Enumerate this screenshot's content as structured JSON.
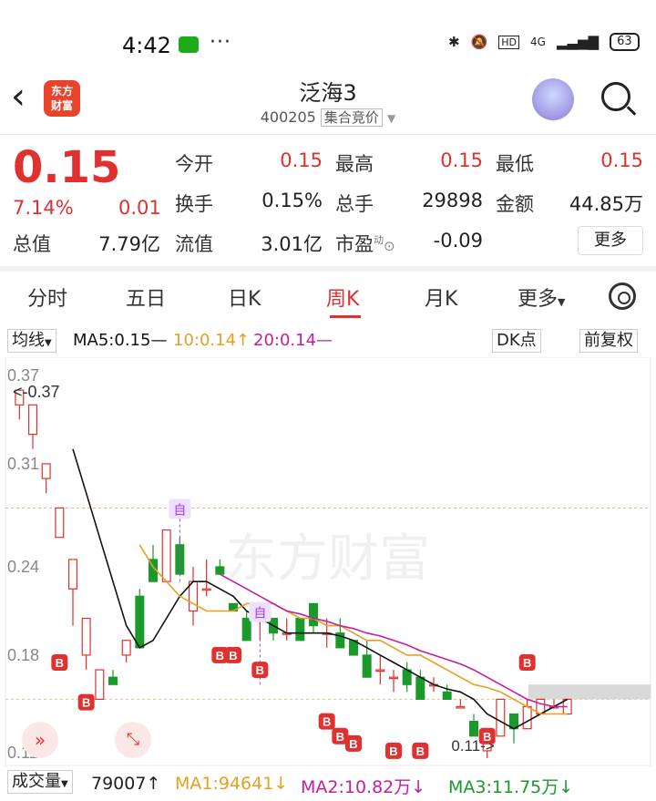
{
  "status": {
    "time": "4:42",
    "dots": "···",
    "network": "4G",
    "battery": "63"
  },
  "header": {
    "title": "泛海3",
    "code": "400205",
    "tag": "集合竞价",
    "logo": "东方\n财富"
  },
  "quote": {
    "price": "0.15",
    "pct": "7.14%",
    "change": "0.01",
    "fields": [
      {
        "label": "今开",
        "value": "0.15",
        "red": true
      },
      {
        "label": "最高",
        "value": "0.15",
        "red": true
      },
      {
        "label": "最低",
        "value": "0.15",
        "red": true
      },
      {
        "label": "换手",
        "value": "0.15%"
      },
      {
        "label": "总手",
        "value": "29898"
      },
      {
        "label": "金额",
        "value": "44.85万"
      },
      {
        "label": "总值",
        "value": "7.79亿"
      },
      {
        "label": "流值",
        "value": "3.01亿"
      },
      {
        "label": "市盈",
        "value": "-0.09"
      }
    ],
    "more": "更多",
    "pe_sup": "动"
  },
  "tabs": [
    "分时",
    "五日",
    "日K",
    "周K",
    "月K",
    "更多"
  ],
  "active_tab": "周K",
  "ma_bar": {
    "select": "均线",
    "ma5": "MA5:0.15—",
    "ma10": "10:0.14↑",
    "ma20": "20:0.14—",
    "dk": "DK点",
    "fq": "前复权"
  },
  "chart_data": {
    "type": "candlestick",
    "y_ticks": [
      "0.37",
      "0.31",
      "0.24",
      "0.18",
      "0.11"
    ],
    "ylim": [
      0.11,
      0.37
    ],
    "max_label": "<-0.37",
    "min_label": "0.11->",
    "marker_label": "自",
    "b_label": "B",
    "watermark": "东方财富",
    "candles": [
      {
        "o": 0.35,
        "h": 0.36,
        "l": 0.34,
        "c": 0.36
      },
      {
        "o": 0.33,
        "h": 0.35,
        "l": 0.32,
        "c": 0.35
      },
      {
        "o": 0.3,
        "h": 0.31,
        "l": 0.29,
        "c": 0.31
      },
      {
        "o": 0.26,
        "h": 0.28,
        "l": 0.26,
        "c": 0.28
      },
      {
        "o": 0.225,
        "h": 0.245,
        "l": 0.2,
        "c": 0.245
      },
      {
        "o": 0.18,
        "h": 0.205,
        "l": 0.17,
        "c": 0.205
      },
      {
        "o": 0.15,
        "h": 0.17,
        "l": 0.15,
        "c": 0.17
      },
      {
        "o": 0.165,
        "h": 0.17,
        "l": 0.16,
        "c": 0.16
      },
      {
        "o": 0.18,
        "h": 0.19,
        "l": 0.175,
        "c": 0.19
      },
      {
        "o": 0.22,
        "h": 0.225,
        "l": 0.185,
        "c": 0.185
      },
      {
        "o": 0.245,
        "h": 0.255,
        "l": 0.23,
        "c": 0.23
      },
      {
        "o": 0.23,
        "h": 0.265,
        "l": 0.23,
        "c": 0.265
      },
      {
        "o": 0.255,
        "h": 0.26,
        "l": 0.235,
        "c": 0.235
      },
      {
        "o": 0.21,
        "h": 0.24,
        "l": 0.2,
        "c": 0.23
      },
      {
        "o": 0.225,
        "h": 0.245,
        "l": 0.22,
        "c": 0.225
      },
      {
        "o": 0.24,
        "h": 0.245,
        "l": 0.235,
        "c": 0.235
      },
      {
        "o": 0.215,
        "h": 0.215,
        "l": 0.21,
        "c": 0.21
      },
      {
        "o": 0.205,
        "h": 0.21,
        "l": 0.19,
        "c": 0.19
      },
      {
        "o": 0.205,
        "h": 0.21,
        "l": 0.19,
        "c": 0.205
      },
      {
        "o": 0.205,
        "h": 0.205,
        "l": 0.19,
        "c": 0.195
      },
      {
        "o": 0.195,
        "h": 0.205,
        "l": 0.19,
        "c": 0.195
      },
      {
        "o": 0.205,
        "h": 0.205,
        "l": 0.19,
        "c": 0.19
      },
      {
        "o": 0.215,
        "h": 0.215,
        "l": 0.195,
        "c": 0.2
      },
      {
        "o": 0.195,
        "h": 0.205,
        "l": 0.185,
        "c": 0.195
      },
      {
        "o": 0.195,
        "h": 0.205,
        "l": 0.185,
        "c": 0.185
      },
      {
        "o": 0.19,
        "h": 0.19,
        "l": 0.18,
        "c": 0.18
      },
      {
        "o": 0.18,
        "h": 0.19,
        "l": 0.165,
        "c": 0.165
      },
      {
        "o": 0.17,
        "h": 0.18,
        "l": 0.16,
        "c": 0.17
      },
      {
        "o": 0.165,
        "h": 0.17,
        "l": 0.155,
        "c": 0.165
      },
      {
        "o": 0.17,
        "h": 0.175,
        "l": 0.155,
        "c": 0.16
      },
      {
        "o": 0.165,
        "h": 0.17,
        "l": 0.15,
        "c": 0.15
      },
      {
        "o": 0.16,
        "h": 0.165,
        "l": 0.155,
        "c": 0.16
      },
      {
        "o": 0.155,
        "h": 0.16,
        "l": 0.15,
        "c": 0.15
      },
      {
        "o": 0.145,
        "h": 0.15,
        "l": 0.145,
        "c": 0.145
      },
      {
        "o": 0.135,
        "h": 0.14,
        "l": 0.125,
        "c": 0.125
      },
      {
        "o": 0.115,
        "h": 0.12,
        "l": 0.11,
        "c": 0.12
      },
      {
        "o": 0.125,
        "h": 0.15,
        "l": 0.125,
        "c": 0.15
      },
      {
        "o": 0.14,
        "h": 0.14,
        "l": 0.12,
        "c": 0.13
      },
      {
        "o": 0.13,
        "h": 0.15,
        "l": 0.13,
        "c": 0.145
      },
      {
        "o": 0.14,
        "h": 0.15,
        "l": 0.14,
        "c": 0.15
      },
      {
        "o": 0.145,
        "h": 0.15,
        "l": 0.145,
        "c": 0.145
      },
      {
        "o": 0.14,
        "h": 0.15,
        "l": 0.14,
        "c": 0.15
      }
    ],
    "ma5": [
      null,
      null,
      null,
      null,
      0.32,
      0.29,
      0.26,
      0.23,
      0.2,
      0.185,
      0.19,
      0.205,
      0.22,
      0.23,
      0.23,
      0.225,
      0.22,
      0.21,
      0.205,
      0.2,
      0.195,
      0.195,
      0.195,
      0.195,
      0.193,
      0.19,
      0.185,
      0.18,
      0.175,
      0.17,
      0.165,
      0.16,
      0.157,
      0.155,
      0.15,
      0.14,
      0.135,
      0.13,
      0.135,
      0.14,
      0.145,
      0.15
    ],
    "ma10": [
      null,
      null,
      null,
      null,
      null,
      null,
      null,
      null,
      null,
      0.255,
      0.24,
      0.23,
      0.22,
      0.215,
      0.21,
      0.21,
      0.21,
      0.215,
      0.215,
      0.215,
      0.21,
      0.205,
      0.205,
      0.2,
      0.2,
      0.195,
      0.19,
      0.19,
      0.185,
      0.18,
      0.18,
      0.175,
      0.17,
      0.165,
      0.16,
      0.158,
      0.155,
      0.15,
      0.145,
      0.14,
      0.14,
      0.14
    ],
    "ma20": [
      null,
      null,
      null,
      null,
      null,
      null,
      null,
      null,
      null,
      null,
      null,
      null,
      null,
      null,
      null,
      0.235,
      0.23,
      0.225,
      0.22,
      0.215,
      0.21,
      0.208,
      0.205,
      0.203,
      0.2,
      0.198,
      0.195,
      0.193,
      0.19,
      0.187,
      0.183,
      0.18,
      0.177,
      0.174,
      0.17,
      0.165,
      0.16,
      0.155,
      0.15,
      0.147,
      0.145,
      0.145
    ]
  },
  "volume": {
    "select": "成交量",
    "vol": "79007↑",
    "ma1": "MA1:94641↓",
    "ma2": "MA2:10.82万↓",
    "ma3": "MA3:11.75万↓"
  },
  "colors": {
    "up": "#e03030",
    "down": "#1a9a2a",
    "ma5": "#111111",
    "ma10": "#e8a020",
    "ma20": "#c020a0",
    "marker": "#a040e0"
  }
}
